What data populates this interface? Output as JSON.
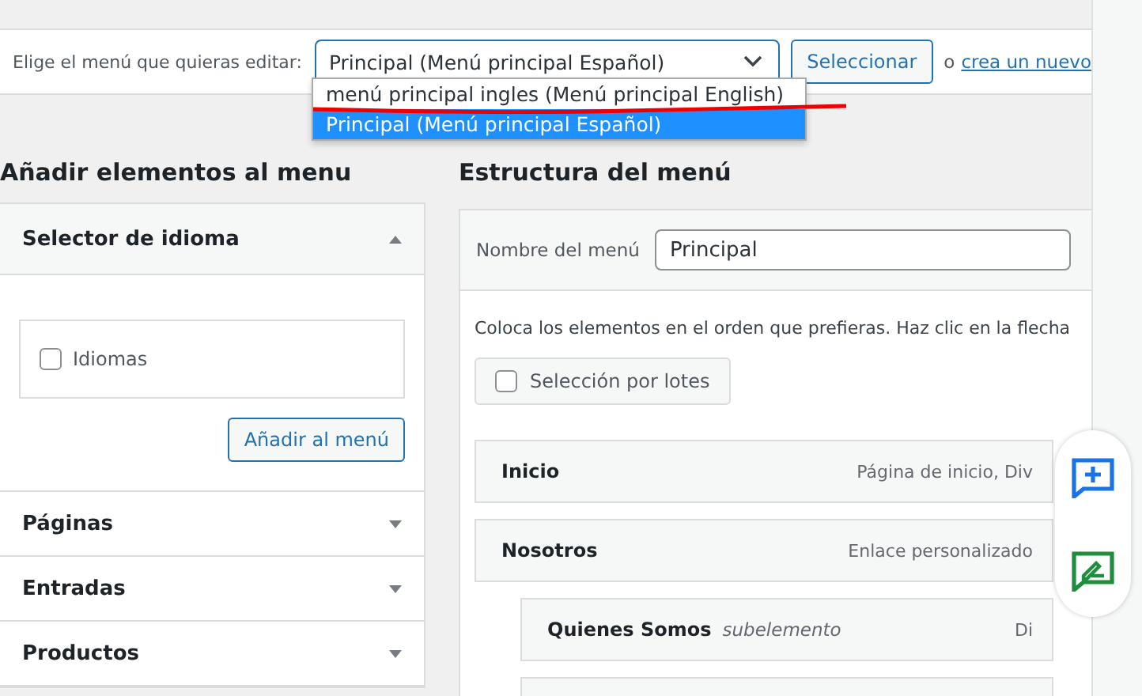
{
  "menu_picker": {
    "label": "Elige el menú que quieras editar:",
    "value": "Principal (Menú principal Español)",
    "button": "Seleccionar",
    "separator": "o",
    "link": "crea un nuevo",
    "options": [
      {
        "label": "menú principal ingles (Menú principal English)",
        "selected": false
      },
      {
        "label": "Principal (Menú principal Español)",
        "selected": true
      }
    ]
  },
  "add_items": {
    "title": "Añadir elementos al menu",
    "sections": [
      {
        "title": "Selector de idioma",
        "expanded": true,
        "items": [
          {
            "label": "Idiomas",
            "checked": false
          }
        ],
        "button": "Añadir al menú"
      },
      {
        "title": "Páginas",
        "expanded": false
      },
      {
        "title": "Entradas",
        "expanded": false
      },
      {
        "title": "Productos",
        "expanded": false
      }
    ]
  },
  "structure": {
    "title": "Estructura del menú",
    "name_label": "Nombre del menú",
    "name_value": "Principal",
    "hint": "Coloca los elementos en el orden que prefieras. Haz clic en la flecha",
    "bulk_select": {
      "label": "Selección por lotes",
      "checked": false
    },
    "items": [
      {
        "title": "Inicio",
        "type": "Página de inicio, Div"
      },
      {
        "title": "Nosotros",
        "type": "Enlace personalizado",
        "children": [
          {
            "title": "Quienes Somos",
            "note": "subelemento",
            "type": "Di"
          }
        ]
      }
    ]
  }
}
